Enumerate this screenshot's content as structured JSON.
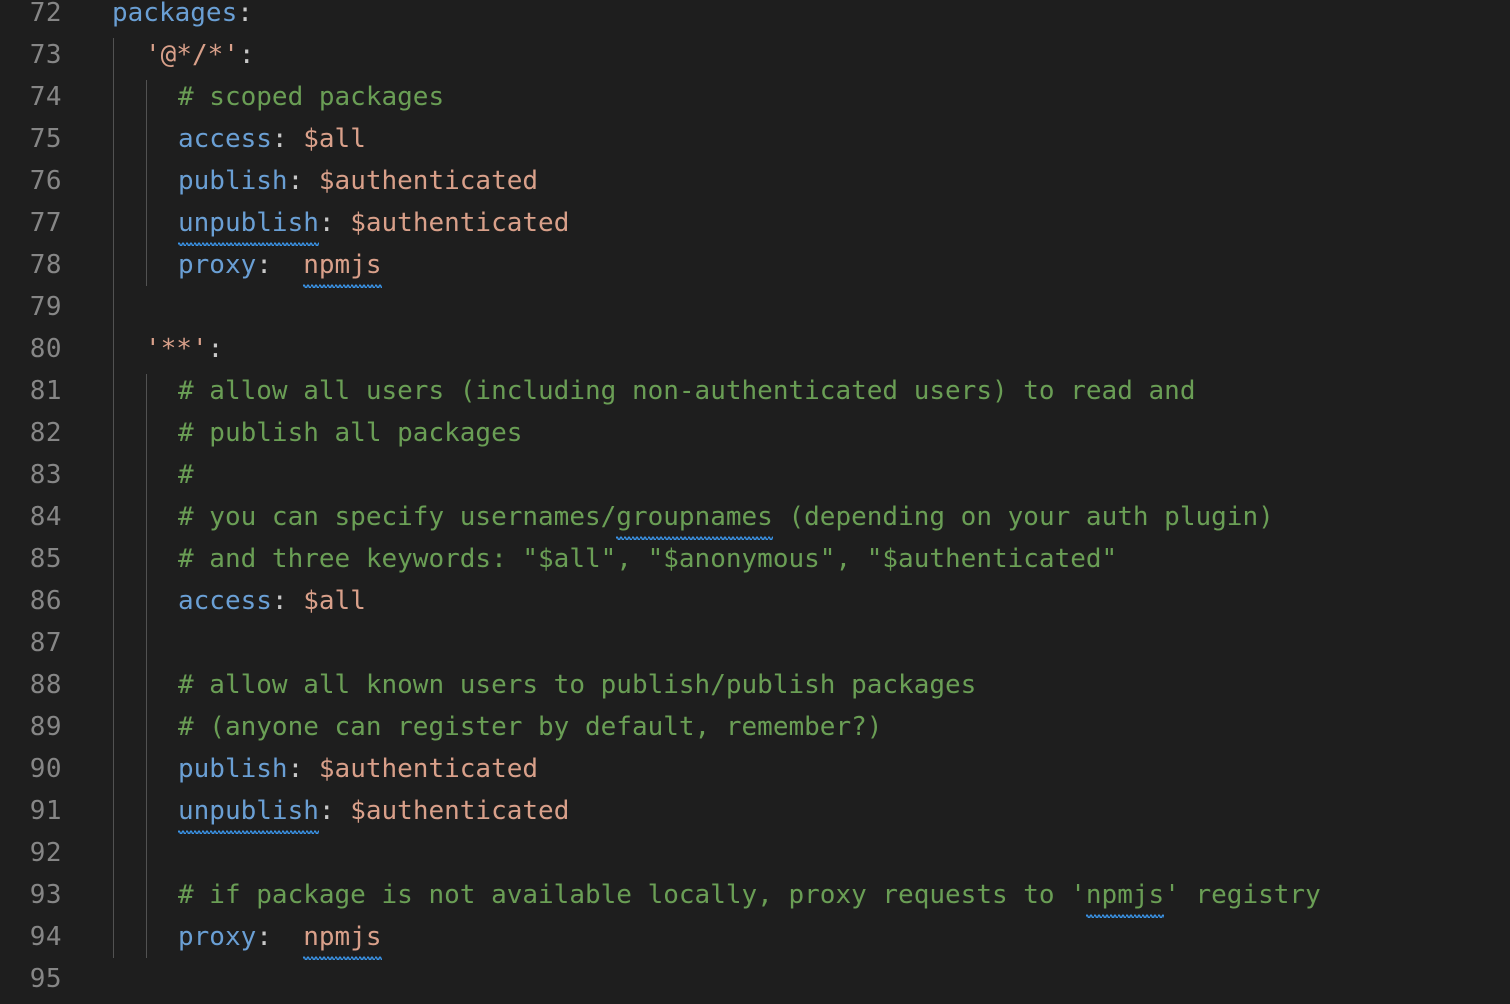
{
  "editor": {
    "theme_background": "#1e1e1e",
    "gutter_foreground": "#868686",
    "language": "yaml",
    "first_line_number": 72,
    "last_line_number": 95,
    "colors": {
      "key": "#6a9fd4",
      "value": "#d9a08a",
      "string": "#d9a08a",
      "comment": "#6a9e55",
      "punctuation": "#c8c8c8",
      "squiggle": "#3a94e8",
      "indent_guide": "#525252"
    }
  },
  "lines": [
    {
      "number": "72",
      "indent": 0,
      "tokens": [
        {
          "t": "packages",
          "c": "key"
        },
        {
          "t": ":",
          "c": "punc"
        }
      ]
    },
    {
      "number": "73",
      "indent": 2,
      "tokens": [
        {
          "t": "'@*/*'",
          "c": "string"
        },
        {
          "t": ":",
          "c": "punc"
        }
      ]
    },
    {
      "number": "74",
      "indent": 4,
      "tokens": [
        {
          "t": "# scoped packages",
          "c": "comment"
        }
      ]
    },
    {
      "number": "75",
      "indent": 4,
      "tokens": [
        {
          "t": "access",
          "c": "key"
        },
        {
          "t": ":",
          "c": "punc"
        },
        {
          "t": " ",
          "c": "plain"
        },
        {
          "t": "$all",
          "c": "value"
        }
      ]
    },
    {
      "number": "76",
      "indent": 4,
      "tokens": [
        {
          "t": "publish",
          "c": "key"
        },
        {
          "t": ":",
          "c": "punc"
        },
        {
          "t": " ",
          "c": "plain"
        },
        {
          "t": "$authenticated",
          "c": "value"
        }
      ]
    },
    {
      "number": "77",
      "indent": 4,
      "tokens": [
        {
          "t": "unpublish",
          "c": "key",
          "sq": true
        },
        {
          "t": ":",
          "c": "punc"
        },
        {
          "t": " ",
          "c": "plain"
        },
        {
          "t": "$authenticated",
          "c": "value"
        }
      ]
    },
    {
      "number": "78",
      "indent": 4,
      "tokens": [
        {
          "t": "proxy",
          "c": "key"
        },
        {
          "t": ":",
          "c": "punc"
        },
        {
          "t": "  ",
          "c": "plain"
        },
        {
          "t": "npmjs",
          "c": "value",
          "sq": true
        }
      ]
    },
    {
      "number": "79",
      "indent": 0,
      "tokens": []
    },
    {
      "number": "80",
      "indent": 2,
      "tokens": [
        {
          "t": "'**'",
          "c": "string"
        },
        {
          "t": ":",
          "c": "punc"
        }
      ]
    },
    {
      "number": "81",
      "indent": 4,
      "tokens": [
        {
          "t": "# allow all users (including non-authenticated users) to read and",
          "c": "comment"
        }
      ]
    },
    {
      "number": "82",
      "indent": 4,
      "tokens": [
        {
          "t": "# publish all packages",
          "c": "comment"
        }
      ]
    },
    {
      "number": "83",
      "indent": 4,
      "tokens": [
        {
          "t": "#",
          "c": "comment"
        }
      ]
    },
    {
      "number": "84",
      "indent": 4,
      "tokens": [
        {
          "t": "# you can specify usernames/",
          "c": "comment"
        },
        {
          "t": "groupnames",
          "c": "comment",
          "sq": true
        },
        {
          "t": " (depending on your auth plugin)",
          "c": "comment"
        }
      ]
    },
    {
      "number": "85",
      "indent": 4,
      "tokens": [
        {
          "t": "# and three keywords: \"$all\", \"$anonymous\", \"$authenticated\"",
          "c": "comment"
        }
      ]
    },
    {
      "number": "86",
      "indent": 4,
      "tokens": [
        {
          "t": "access",
          "c": "key"
        },
        {
          "t": ":",
          "c": "punc"
        },
        {
          "t": " ",
          "c": "plain"
        },
        {
          "t": "$all",
          "c": "value"
        }
      ]
    },
    {
      "number": "87",
      "indent": 0,
      "tokens": []
    },
    {
      "number": "88",
      "indent": 4,
      "tokens": [
        {
          "t": "# allow all known users to publish/publish packages",
          "c": "comment"
        }
      ]
    },
    {
      "number": "89",
      "indent": 4,
      "tokens": [
        {
          "t": "# (anyone can register by default, remember?)",
          "c": "comment"
        }
      ]
    },
    {
      "number": "90",
      "indent": 4,
      "tokens": [
        {
          "t": "publish",
          "c": "key"
        },
        {
          "t": ":",
          "c": "punc"
        },
        {
          "t": " ",
          "c": "plain"
        },
        {
          "t": "$authenticated",
          "c": "value"
        }
      ]
    },
    {
      "number": "91",
      "indent": 4,
      "tokens": [
        {
          "t": "unpublish",
          "c": "key",
          "sq": true
        },
        {
          "t": ":",
          "c": "punc"
        },
        {
          "t": " ",
          "c": "plain"
        },
        {
          "t": "$authenticated",
          "c": "value"
        }
      ]
    },
    {
      "number": "92",
      "indent": 0,
      "tokens": []
    },
    {
      "number": "93",
      "indent": 4,
      "tokens": [
        {
          "t": "# if package is not available locally, proxy requests to '",
          "c": "comment"
        },
        {
          "t": "npmjs",
          "c": "comment",
          "sq": true
        },
        {
          "t": "' registry",
          "c": "comment"
        }
      ]
    },
    {
      "number": "94",
      "indent": 4,
      "tokens": [
        {
          "t": "proxy",
          "c": "key"
        },
        {
          "t": ":",
          "c": "punc"
        },
        {
          "t": "  ",
          "c": "plain"
        },
        {
          "t": "npmjs",
          "c": "value",
          "sq": true
        }
      ]
    },
    {
      "number": "95",
      "indent": 0,
      "tokens": []
    }
  ],
  "indent_guides": [
    {
      "column": 0,
      "from_line": "73",
      "to_line": "94"
    },
    {
      "column": 2,
      "from_line": "74",
      "to_line": "78"
    },
    {
      "column": 2,
      "from_line": "81",
      "to_line": "94"
    }
  ]
}
